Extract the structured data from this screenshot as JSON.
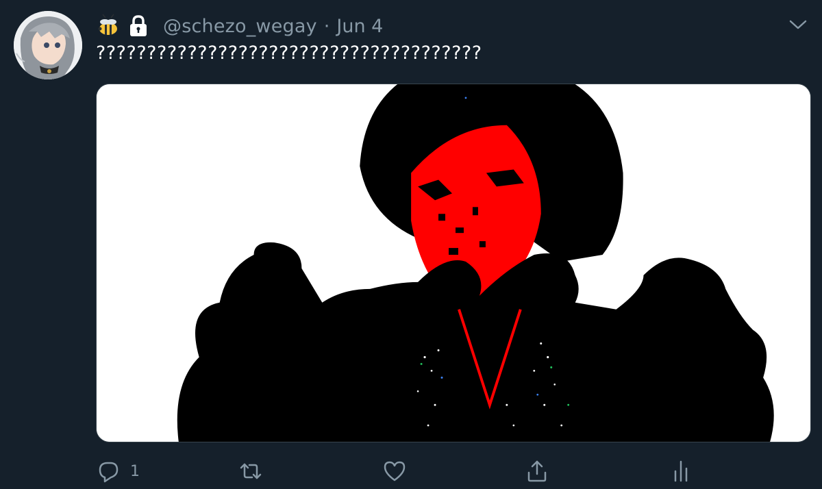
{
  "tweet": {
    "handle": "@schezo_wegay",
    "separator": "·",
    "date": "Jun 4",
    "text": "??????????????????????????????????????",
    "badges": [
      "bee-emoji",
      "lock-icon"
    ]
  },
  "actions": {
    "reply_count": "1",
    "retweet_count": "",
    "like_count": ""
  },
  "colors": {
    "background": "#15202b",
    "secondary_text": "#8899a6",
    "media_background": "#ffffff",
    "media_accent": "#ff0000"
  }
}
